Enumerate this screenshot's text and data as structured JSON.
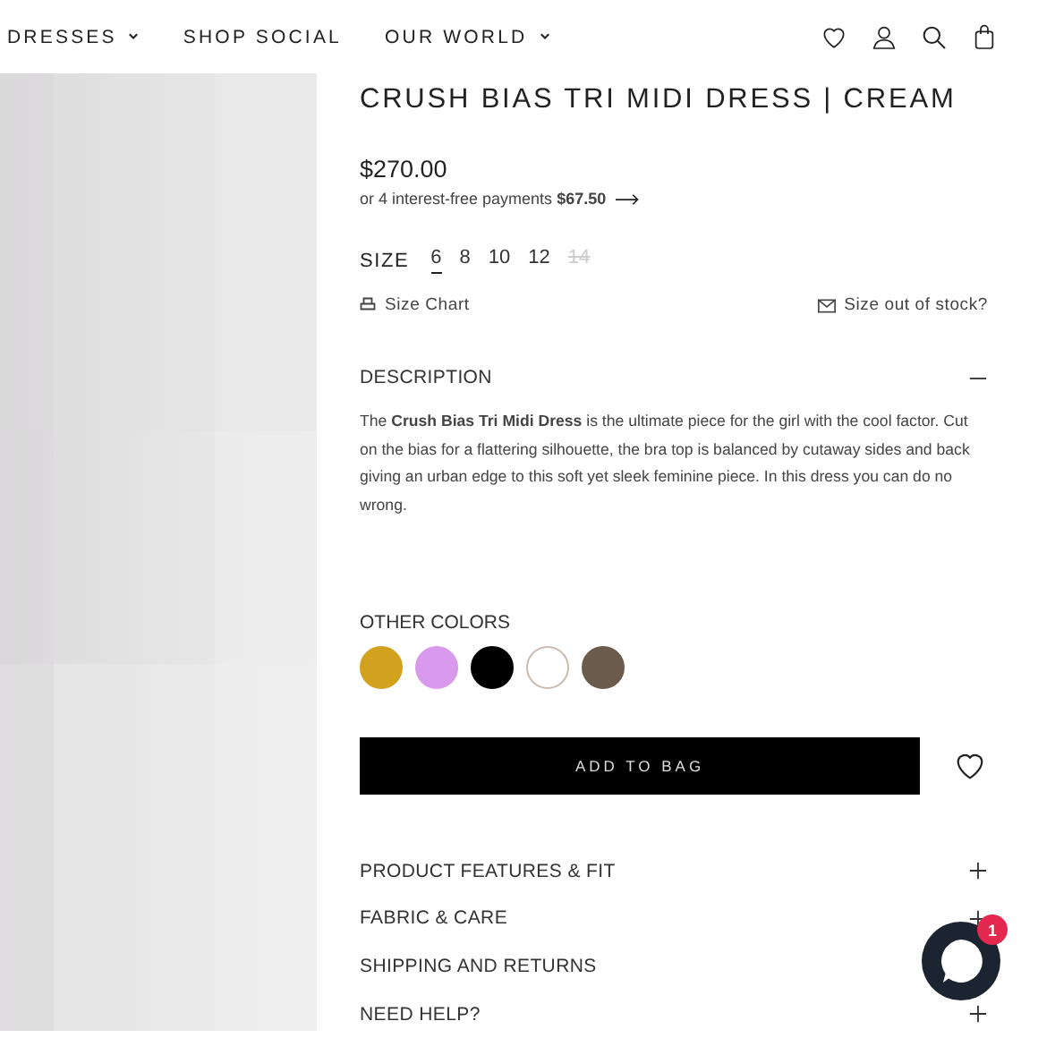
{
  "nav": {
    "items": [
      {
        "label": "DRESSES",
        "dropdown": true
      },
      {
        "label": "SHOP SOCIAL",
        "dropdown": false
      },
      {
        "label": "OUR WORLD",
        "dropdown": true
      }
    ]
  },
  "product": {
    "title": "CRUSH BIAS TRI MIDI DRESS | CREAM",
    "price": "$270.00",
    "installments": "or 4 interest-free payments **$67.50**",
    "size_label": "SIZE",
    "sizes": [
      {
        "label": "6",
        "selected": true,
        "disabled": false
      },
      {
        "label": "8",
        "selected": false,
        "disabled": false
      },
      {
        "label": "10",
        "selected": false,
        "disabled": false
      },
      {
        "label": "12",
        "selected": false,
        "disabled": false
      },
      {
        "label": "14",
        "selected": false,
        "disabled": true
      }
    ],
    "size_chart": "Size Chart",
    "size_out": "Size out of stock?",
    "colors_label": "OTHER COLORS",
    "colors": [
      {
        "color": "#d2a21f"
      },
      {
        "color": "#d99aed"
      },
      {
        "color": "#000000"
      },
      {
        "color": "#ffffff"
      },
      {
        "color": "#6b5b4c"
      }
    ],
    "add_to_bag": "ADD TO BAG"
  },
  "accordions": [
    {
      "title": "DESCRIPTION",
      "expanded": true,
      "body": "The **Crush Bias Tri Midi Dress** is the ultimate piece for the girl with the cool factor. Cut on the bias for a flattering silhouette, the bra top is balanced by cutaway sides and back giving an urban edge to this soft yet sleek feminine piece. In this dress you can do no wrong."
    },
    {
      "title": "PRODUCT FEATURES & FIT",
      "expanded": false
    },
    {
      "title": "FABRIC & CARE",
      "expanded": false
    },
    {
      "title": "SHIPPING AND RETURNS"
    },
    {
      "title": "NEED HELP?",
      "expanded": false
    }
  ],
  "chat": {
    "badge": "1"
  }
}
